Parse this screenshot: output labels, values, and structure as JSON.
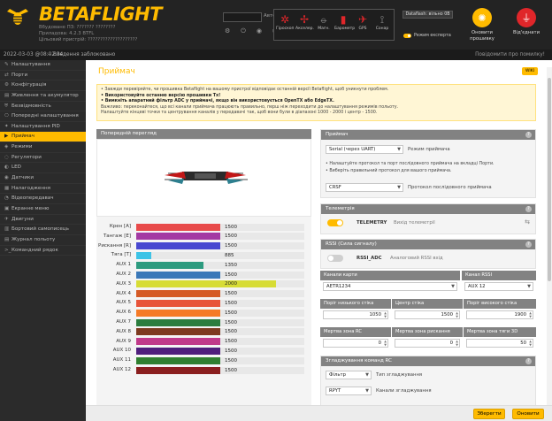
{
  "header": {
    "logo_text": "BETAFLIGHT",
    "logo_sub": [
      "Вбудоване ПЗ: ??????? ????????",
      "Приладова: 4.2.3 BTFL",
      "Цільовий пристрій: ????????????????????"
    ],
    "port_label": "Автопідбір",
    "icons": [
      "⚙",
      "⏻",
      "◉",
      "⬡"
    ],
    "sensors": [
      {
        "icon": "gyro-icon",
        "glyph": "✲",
        "label": "Гіроскоп"
      },
      {
        "icon": "accel-icon",
        "glyph": "✢",
        "label": "Акселер."
      },
      {
        "icon": "mag-icon",
        "glyph": "⦵",
        "label": "Магн."
      },
      {
        "icon": "baro-icon",
        "glyph": "▮",
        "label": "Барометр"
      },
      {
        "icon": "gps-icon",
        "glyph": "✈",
        "label": "GPS"
      },
      {
        "icon": "sonar-icon",
        "glyph": "⟟",
        "label": "Сонар"
      }
    ],
    "dataflash": "Dataflash: вільно 0B",
    "expert_mode": "Режим експерта",
    "update_button": "Оновити прошивку",
    "disconnect_button": "Від'єднати",
    "colors": {
      "accent": "#ffbb00",
      "danger": "#e0262a"
    }
  },
  "status": {
    "datetime": "2022-03-03 @08:02:34",
    "connection": "-- Введення заблоковано",
    "right": "Повідомити про помилку!"
  },
  "sidebar": {
    "items": [
      {
        "icon": "✎",
        "label": "Налаштування",
        "active": false
      },
      {
        "icon": "⇄",
        "label": "Порти",
        "active": false
      },
      {
        "icon": "⚙",
        "label": "Конфігурація",
        "active": false
      },
      {
        "icon": "▤",
        "label": "Живлення та акумулятор",
        "active": false
      },
      {
        "icon": "⛨",
        "label": "Безвідмовність",
        "active": false
      },
      {
        "icon": "⎔",
        "label": "Попередні налаштування",
        "active": false
      },
      {
        "icon": "✦",
        "label": "Налаштування PID",
        "active": false
      },
      {
        "icon": "▶",
        "label": "Приймач",
        "active": true
      },
      {
        "icon": "◈",
        "label": "Режими",
        "active": false
      },
      {
        "icon": "◌",
        "label": "Регулятори",
        "active": false
      },
      {
        "icon": "◐",
        "label": "LED",
        "active": false
      },
      {
        "icon": "◉",
        "label": "Датчики",
        "active": false
      },
      {
        "icon": "▦",
        "label": "Налагодження",
        "active": false
      },
      {
        "icon": "◔",
        "label": "Відеопередавач",
        "active": false
      },
      {
        "icon": "▣",
        "label": "Екранне меню",
        "active": false
      },
      {
        "icon": "✈",
        "label": "Двигуни",
        "active": false
      },
      {
        "icon": "▥",
        "label": "Бортовий самописець",
        "active": false
      },
      {
        "icon": "▤",
        "label": "Журнал польоту",
        "active": false
      },
      {
        "icon": ">_",
        "label": "Командний рядок",
        "active": false
      }
    ]
  },
  "page": {
    "title": "Приймач",
    "wiki": "WIKI",
    "notice_lines": [
      "• Завжди перевіряйте, чи прошивка Betaflight на вашому пристрої відповідає останній версії Betaflight, щоб уникнути проблем.",
      "• Використовуйте останню версію прошивки Tx!",
      "• Вимкніть апаратний фільтр ADC у приймачі, якщо він використовується OpenTX або EdgeTX.",
      "Важливо: переконайтеся, що всі канали приймача працюють правильно, перш ніж переходити до налаштування режимів польоту.",
      "Налаштуйте кінцеві точки та центрування каналів у передавачі так, щоб вони були в діапазоні 1000 - 2000 і центр - 1500."
    ]
  },
  "preview_title": "Попередній перегляд",
  "chart_data": {
    "type": "bar",
    "categories": [
      "Крен [A]",
      "Тангаж [E]",
      "Рискання [R]",
      "Тяга [T]",
      "AUX 1",
      "AUX 2",
      "AUX 3",
      "AUX 4",
      "AUX 5",
      "AUX 6",
      "AUX 7",
      "AUX 8",
      "AUX 9",
      "AUX 10",
      "AUX 11",
      "AUX 12"
    ],
    "values": [
      1500,
      1500,
      1500,
      885,
      1350,
      1500,
      2000,
      1500,
      1500,
      1500,
      1500,
      1500,
      1500,
      1500,
      1500,
      1500
    ],
    "colors": [
      "#e84a4a",
      "#a33aa3",
      "#4848d0",
      "#3dc3e6",
      "#2d9b7f",
      "#3a78b8",
      "#d7dc35",
      "#d55a25",
      "#e8543a",
      "#f57a26",
      "#2c7d3e",
      "#7d3a1f",
      "#c03a8a",
      "#4e1e7c",
      "#2f7f2f",
      "#8a1e1e"
    ],
    "ylim": [
      750,
      2250
    ]
  },
  "receiver": {
    "title": "Приймач",
    "mode_select": "Serial (через UART)",
    "mode_label": "Режим приймача",
    "hint1": "• Налаштуйте протокол та порт послідовного приймача на вкладці Порти.",
    "hint2": "• Виберіть правильний протокол для вашого приймача.",
    "provider_select": "CRSF",
    "provider_label": "Протокол послідовного приймача"
  },
  "telemetry": {
    "title": "Телеметрія",
    "label": "TELEMETRY",
    "desc": "Вихід телеметрії"
  },
  "rssi": {
    "title": "RSSI (Сила сигналу)",
    "label": "RSSI_ADC",
    "desc": "Аналоговий RSSI вхід"
  },
  "channel_map": {
    "title": "Канали карти",
    "value": "AETR1234"
  },
  "rssi_channel": {
    "title": "Канал RSSI",
    "value": "AUX 12"
  },
  "stick": {
    "low_label": "Поріг низького стіка",
    "low_value": "1050",
    "center_label": "Центр стіка",
    "center_value": "1500",
    "high_label": "Поріг високого стіка",
    "high_value": "1900"
  },
  "deadband": {
    "rc_label": "Мертва зона RC",
    "rc_value": "0",
    "yaw_label": "Мертва зона рискання",
    "yaw_value": "0",
    "throttle_label": "Мертва зона тяги 3D",
    "throttle_value": "50"
  },
  "smoothing": {
    "title": "Згладжування команд RC",
    "type_value": "Фільтр",
    "type_label": "Тип згладжування",
    "source_value": "RPYT",
    "source_label": "Канали згладжування"
  },
  "buttons": {
    "save": "Зберегти",
    "refresh": "Оновити"
  }
}
